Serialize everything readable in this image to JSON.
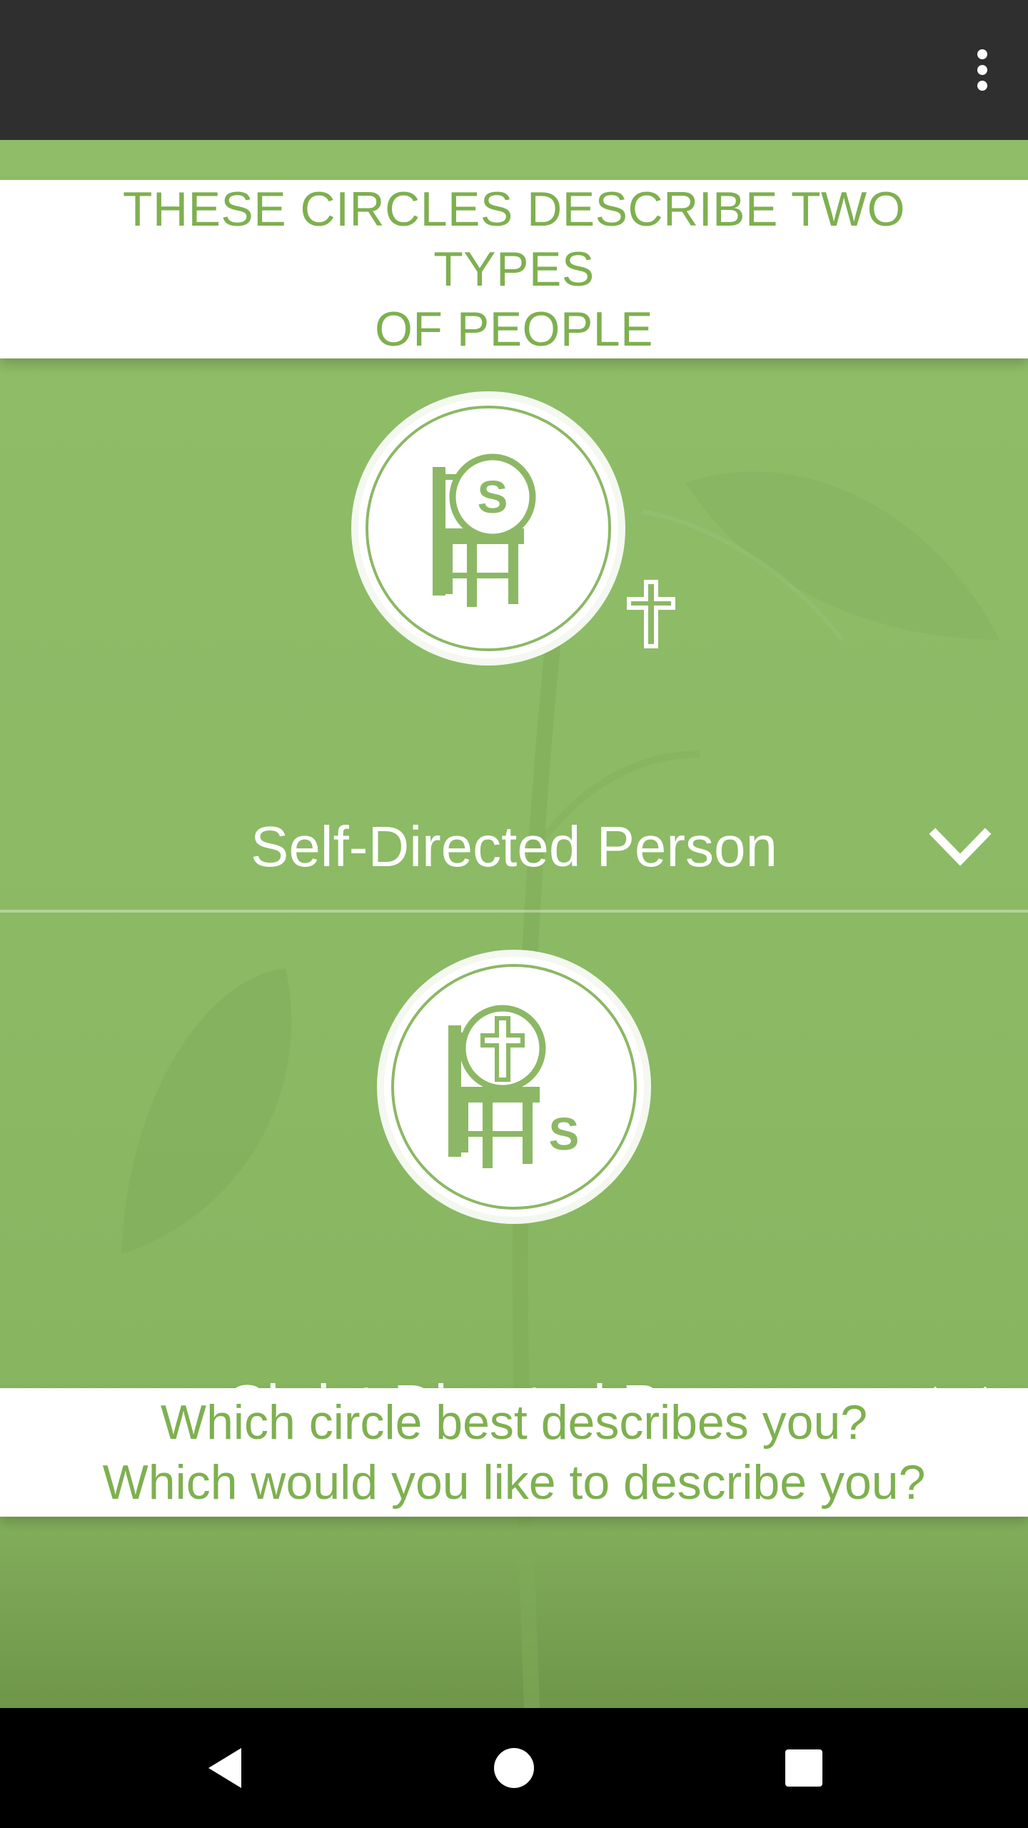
{
  "app_bar": {
    "menu_icon": "more-vert-icon"
  },
  "title_card": {
    "line1": "THESE CIRCLES DESCRIBE TWO TYPES",
    "line2": "OF PEOPLE"
  },
  "sections": [
    {
      "label": "Self-Directed Person",
      "icon": "self-directed-circle-icon",
      "circle_letter": "S",
      "outside_glyph": "cross",
      "expand_icon": "chevron-down-icon"
    },
    {
      "label": "Christ-Directed Person",
      "icon": "christ-directed-circle-icon",
      "circle_letter": "S",
      "inside_glyph": "cross",
      "expand_icon": "chevron-down-icon"
    }
  ],
  "question_card": {
    "line1": "Which circle best describes you?",
    "line2": "Which would you like to describe you?"
  },
  "nav_bar": {
    "back_icon": "back-triangle-icon",
    "home_icon": "home-circle-icon",
    "recents_icon": "recents-square-icon"
  },
  "colors": {
    "app_bar": "#2f2f2f",
    "green_background": "#8cb865",
    "accent_text": "#7eb04f",
    "white": "#ffffff",
    "nav_bar": "#000000"
  }
}
